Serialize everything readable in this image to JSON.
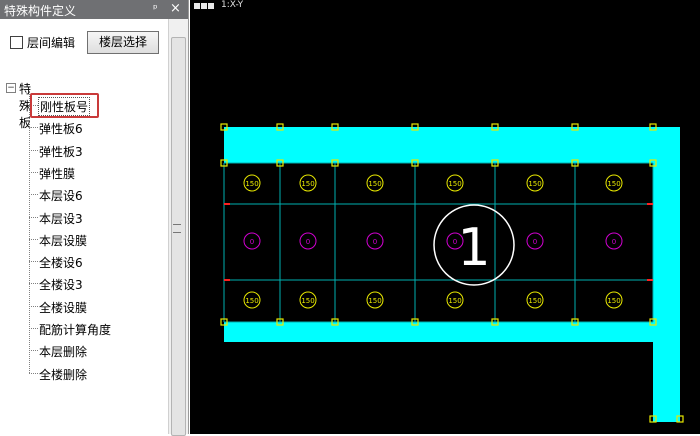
{
  "panel": {
    "title": "特殊构件定义",
    "pin_icon": "ᵖ",
    "close_icon": "×",
    "checkbox_label": "层间编辑",
    "checkbox_checked": false,
    "floor_button": "楼层选择"
  },
  "tree": {
    "root_label": "特殊板",
    "expand_glyph": "−",
    "items": [
      "刚性板号",
      "弹性板6",
      "弹性板3",
      "弹性膜",
      "本层设6",
      "本层设3",
      "本层设膜",
      "全楼设6",
      "全楼设3",
      "全楼设膜",
      "配筋计算角度",
      "本层删除",
      "全楼删除"
    ],
    "selected_index": 0
  },
  "view": {
    "label": "1:X-Y",
    "big_number": "1",
    "slab_top_label": "150",
    "slab_bottom_label": "150",
    "slab_mid_label": "0",
    "colors": {
      "beam": "#00ffff",
      "grid": "#00b0b0",
      "column": "#e8e800",
      "mid_circle": "#d000d0",
      "node": "#ff2020",
      "big_circle": "#ffffff"
    }
  }
}
